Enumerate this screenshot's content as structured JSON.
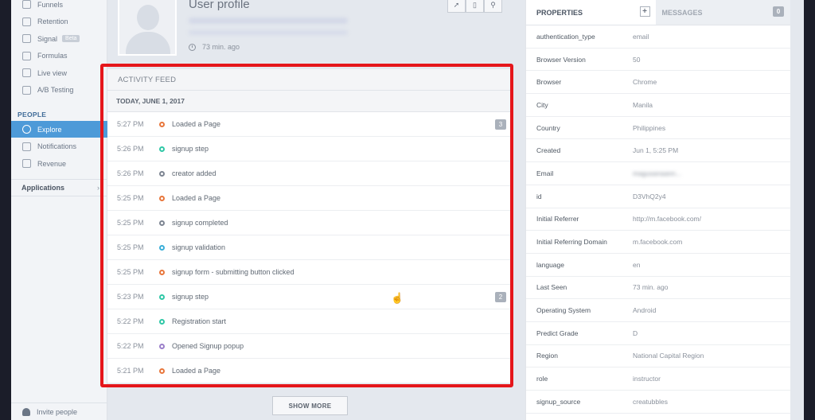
{
  "sidebar": {
    "items": [
      {
        "label": "Funnels",
        "icon": "funnel-icon"
      },
      {
        "label": "Retention",
        "icon": "retention-icon"
      },
      {
        "label": "Signal",
        "icon": "signal-icon",
        "badge": "Beta"
      },
      {
        "label": "Formulas",
        "icon": "formula-icon"
      },
      {
        "label": "Live view",
        "icon": "live-view-icon"
      },
      {
        "label": "A/B Testing",
        "icon": "ab-testing-icon"
      }
    ],
    "people_section": "PEOPLE",
    "people_items": [
      {
        "label": "Explore",
        "icon": "explore-icon",
        "active": true
      },
      {
        "label": "Notifications",
        "icon": "notifications-icon"
      },
      {
        "label": "Revenue",
        "icon": "revenue-icon"
      }
    ],
    "applications": "Applications",
    "invite": "Invite people"
  },
  "profile": {
    "title": "User profile",
    "last_seen": "73 min. ago"
  },
  "feed": {
    "title": "ACTIVITY FEED",
    "date": "TODAY, JUNE 1, 2017",
    "events": [
      {
        "time": "5:27 PM",
        "label": "Loaded a Page",
        "color": "#e8763b",
        "count": "3"
      },
      {
        "time": "5:26 PM",
        "label": "signup step",
        "color": "#2fc7a6",
        "count": ""
      },
      {
        "time": "5:26 PM",
        "label": "creator added",
        "color": "#7d8592",
        "count": ""
      },
      {
        "time": "5:25 PM",
        "label": "Loaded a Page",
        "color": "#e8763b",
        "count": ""
      },
      {
        "time": "5:25 PM",
        "label": "signup completed",
        "color": "#7d8592",
        "count": ""
      },
      {
        "time": "5:25 PM",
        "label": "signup validation",
        "color": "#3aaed8",
        "count": ""
      },
      {
        "time": "5:25 PM",
        "label": "signup form - submitting button clicked",
        "color": "#e8763b",
        "count": ""
      },
      {
        "time": "5:23 PM",
        "label": "signup step",
        "color": "#2fc7a6",
        "count": "2"
      },
      {
        "time": "5:22 PM",
        "label": "Registration start",
        "color": "#2fc7a6",
        "count": ""
      },
      {
        "time": "5:22 PM",
        "label": "Opened Signup popup",
        "color": "#9b7fc9",
        "count": ""
      },
      {
        "time": "5:21 PM",
        "label": "Loaded a Page",
        "color": "#e8763b",
        "count": ""
      }
    ],
    "show_more": "SHOW MORE"
  },
  "properties": {
    "tab_properties": "PROPERTIES",
    "tab_messages": "MESSAGES",
    "messages_count": "0",
    "rows": [
      {
        "key": "authentication_type",
        "value": "email"
      },
      {
        "key": "Browser Version",
        "value": "50"
      },
      {
        "key": "Browser",
        "value": "Chrome"
      },
      {
        "key": "City",
        "value": "Manila"
      },
      {
        "key": "Country",
        "value": "Philippines"
      },
      {
        "key": "Created",
        "value": "Jun 1, 5:25 PM"
      },
      {
        "key": "Email",
        "value": "magusanaann...",
        "blurred": true
      },
      {
        "key": "id",
        "value": "D3VhQ2y4"
      },
      {
        "key": "Initial Referrer",
        "value": "http://m.facebook.com/"
      },
      {
        "key": "Initial Referring Domain",
        "value": "m.facebook.com"
      },
      {
        "key": "language",
        "value": "en"
      },
      {
        "key": "Last Seen",
        "value": "73 min. ago"
      },
      {
        "key": "Operating System",
        "value": "Android"
      },
      {
        "key": "Predict Grade",
        "value": "D"
      },
      {
        "key": "Region",
        "value": "National Capital Region"
      },
      {
        "key": "role",
        "value": "instructor"
      },
      {
        "key": "signup_source",
        "value": "creatubbles"
      }
    ]
  }
}
